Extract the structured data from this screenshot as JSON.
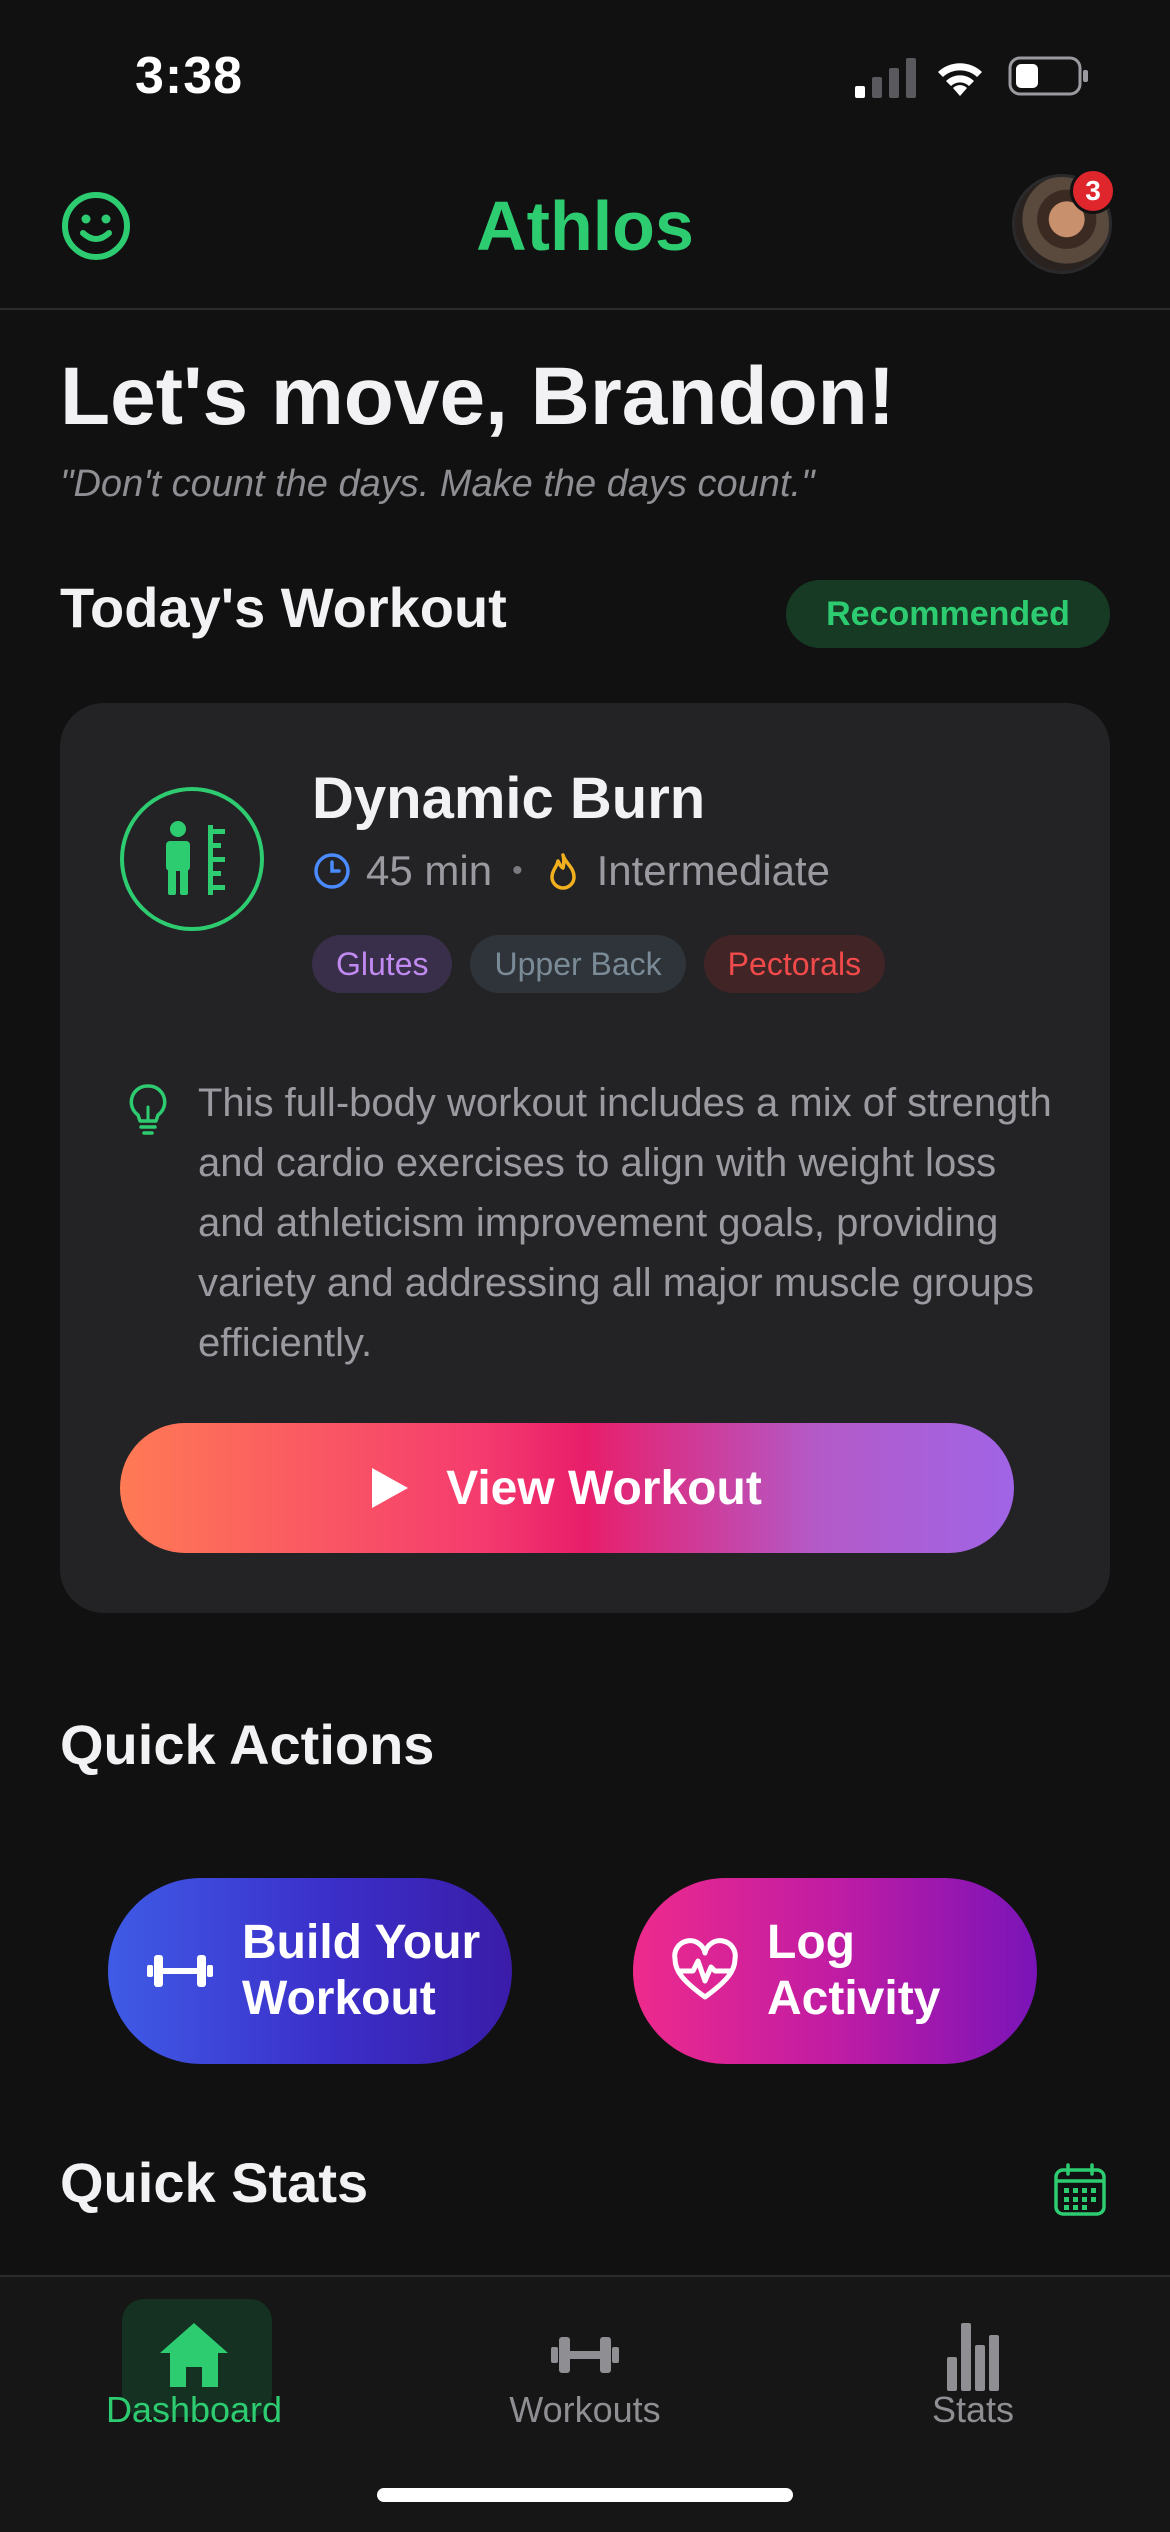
{
  "status_bar": {
    "time": "3:38"
  },
  "header": {
    "title": "Athlos",
    "notification_count": "3"
  },
  "greeting": {
    "headline": "Let's move, Brandon!",
    "quote": "\"Don't count the days. Make the days count.\""
  },
  "todays_workout": {
    "section_title": "Today's Workout",
    "badge": "Recommended",
    "name": "Dynamic Burn",
    "duration": "45 min",
    "level": "Intermediate",
    "muscles": [
      "Glutes",
      "Upper Back",
      "Pectorals"
    ],
    "description": "This full-body workout includes a mix of strength and cardio exercises to align with weight loss and athleticism improvement goals, providing variety and addressing all major muscle groups efficiently.",
    "cta": "View Workout"
  },
  "quick_actions": {
    "section_title": "Quick Actions",
    "build": {
      "line1": "Build Your",
      "line2": "Workout"
    },
    "log": {
      "line1": "Log",
      "line2": "Activity"
    }
  },
  "quick_stats": {
    "section_title": "Quick Stats"
  },
  "tab_bar": {
    "tabs": [
      {
        "label": "Dashboard",
        "active": true
      },
      {
        "label": "Workouts",
        "active": false
      },
      {
        "label": "Stats",
        "active": false
      }
    ]
  },
  "colors": {
    "accent": "#2ecc71",
    "background": "#111112",
    "card": "#232325",
    "badge_red": "#e0262d",
    "tag_glutes": "#c08af0",
    "tag_upper_back": "#7a8b97",
    "tag_pectorals": "#f04a4a",
    "tab_inactive": "#8e8e93"
  },
  "icons": {
    "header_left": "smiley-icon",
    "workout": "person-height-icon",
    "duration": "clock-icon",
    "level": "flame-icon",
    "tip": "lightbulb-icon",
    "build": "dumbbell-icon",
    "log": "heart-pulse-icon",
    "stats_calendar": "calendar-icon"
  }
}
